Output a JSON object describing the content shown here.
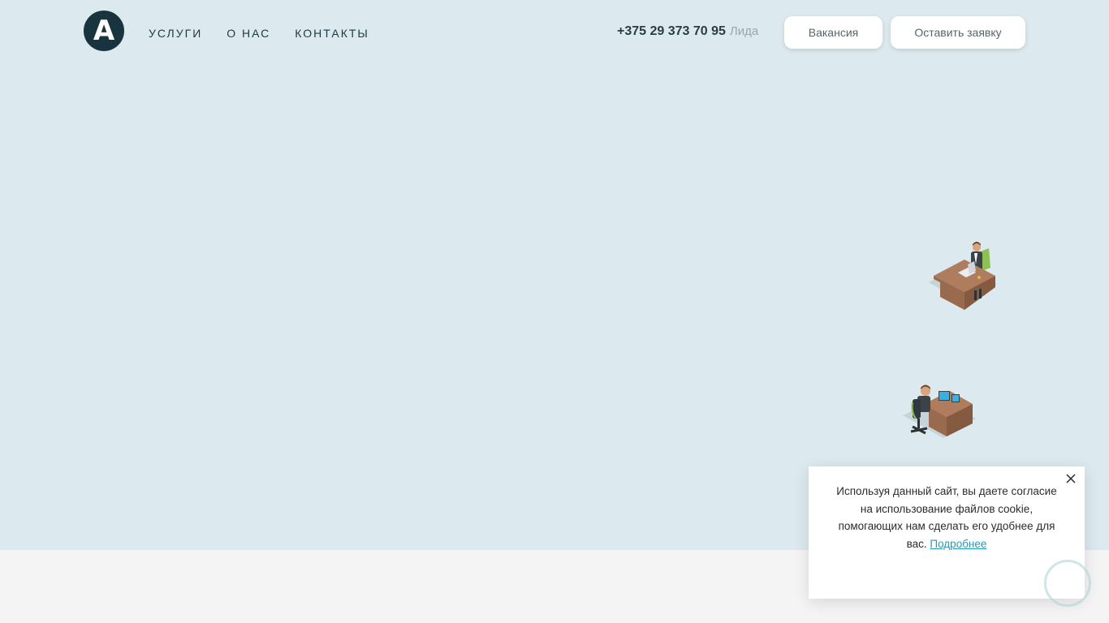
{
  "header": {
    "logo_letter": "A",
    "nav": [
      {
        "label": "УСЛУГИ"
      },
      {
        "label": "О НАС"
      },
      {
        "label": "КОНТАКТЫ"
      }
    ],
    "phone": "+375 29 373 70 95",
    "city": "Лида",
    "buttons": {
      "vacancy": "Вакансия",
      "request": "Оставить заявку"
    }
  },
  "cookie_banner": {
    "text": "Используя данный сайт, вы даете согласие на использование файлов cookie, помогающих нам сделать его удобнее для вас.",
    "link": "Подробнее",
    "close_icon": "close-icon"
  },
  "colors": {
    "hero_bg": "#dce9ee",
    "page_bg": "#f4f4f4",
    "logo_bg": "#18353f",
    "link": "#2a9ab0"
  }
}
